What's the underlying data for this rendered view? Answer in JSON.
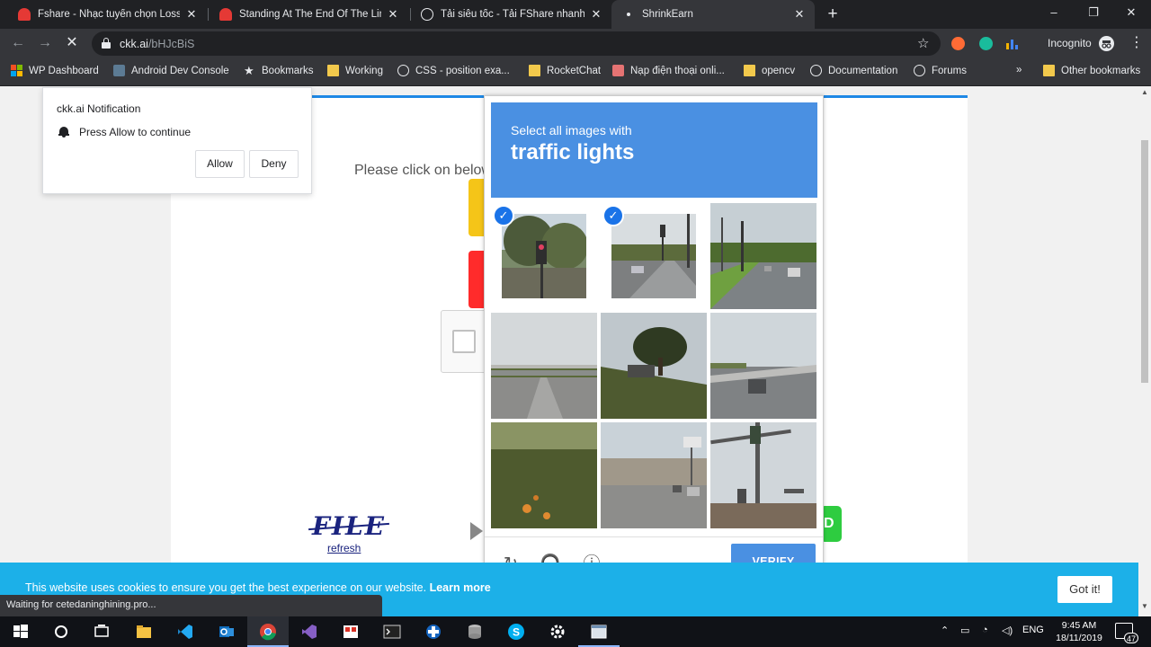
{
  "browser": {
    "tabs": [
      {
        "title": "Fshare - Nhạc tuyển chọn Lossless",
        "favicon": "red-cloud-icon"
      },
      {
        "title": "Standing At The End Of The Line",
        "favicon": "red-cloud-icon"
      },
      {
        "title": "Tải siêu tốc - Tải FShare nhanh nhất",
        "favicon": "globe-icon"
      },
      {
        "title": "ShrinkEarn",
        "favicon": "loading-dot-icon",
        "active": true
      }
    ],
    "new_tab": "+",
    "window_controls": {
      "minimize": "–",
      "maximize": "❐",
      "close": "✕"
    },
    "nav": {
      "back": "←",
      "forward": "→",
      "stop": "✕"
    },
    "url_host": "ckk.ai",
    "url_path": "/bHJcBiS",
    "star": "☆",
    "profile_label": "Incognito",
    "menu": "⋮",
    "bookmarks": [
      {
        "label": "WP Dashboard",
        "icon": "windows-icon"
      },
      {
        "label": "Android Dev Console",
        "icon": "android-icon"
      },
      {
        "label": "Bookmarks",
        "icon": "star-icon"
      },
      {
        "label": "Working",
        "icon": "folder-icon"
      },
      {
        "label": "CSS - position exa...",
        "icon": "globe-icon"
      },
      {
        "label": "RocketChat",
        "icon": "folder-icon"
      },
      {
        "label": "Nạp điện thoại onli...",
        "icon": "bookmark-icon"
      },
      {
        "label": "opencv",
        "icon": "folder-icon"
      },
      {
        "label": "Documentation",
        "icon": "globe-icon"
      },
      {
        "label": "Forums",
        "icon": "globe-icon"
      }
    ],
    "bookmarks_overflow": "»",
    "other_bookmarks": "Other bookmarks"
  },
  "notification": {
    "site": "ckk.ai Notification",
    "message": "Press Allow to continue",
    "allow": "Allow",
    "deny": "Deny"
  },
  "page": {
    "instruction": "Please click on below",
    "file_logo": "FILE",
    "file_refresh": "refresh",
    "green_button": "D"
  },
  "captcha": {
    "prompt": "Select all images with",
    "keyword": "traffic lights",
    "tiles": [
      {
        "name": "tile-1",
        "selected": true
      },
      {
        "name": "tile-2",
        "selected": true
      },
      {
        "name": "tile-3",
        "selected": false
      },
      {
        "name": "tile-4",
        "selected": false
      },
      {
        "name": "tile-5",
        "selected": false
      },
      {
        "name": "tile-6",
        "selected": false
      },
      {
        "name": "tile-7",
        "selected": false
      },
      {
        "name": "tile-8",
        "selected": false
      },
      {
        "name": "tile-9",
        "selected": false
      }
    ],
    "verify": "VERIFY",
    "check_mark": "✓",
    "reload_icon": "↻",
    "audio_icon": "🎧",
    "info_icon": "ⓘ"
  },
  "cookie": {
    "text": "This website uses cookies to ensure you get the best experience on our website.",
    "link": "Learn more",
    "button": "Got it!"
  },
  "status": "Waiting for cetedaninghining.pro...",
  "taskbar": {
    "clock_time": "9:45 AM",
    "clock_date": "18/11/2019",
    "language": "ENG",
    "notification_count": "47"
  },
  "colors": {
    "captcha_blue": "#4a90e2",
    "cookie_blue": "#1cb0e8",
    "chrome_dark": "#202124"
  }
}
